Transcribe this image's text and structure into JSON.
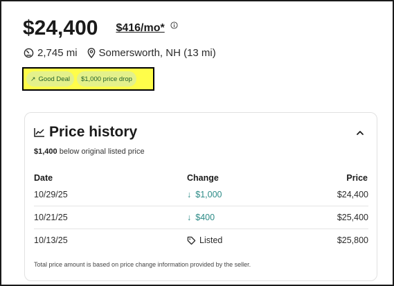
{
  "listing": {
    "price": "$24,400",
    "monthly": "$416/mo*",
    "mileage": "2,745 mi",
    "location": "Somersworth, NH (13 mi)"
  },
  "badges": [
    {
      "label": "Good Deal",
      "icon": "trend-up-arrow-icon"
    },
    {
      "label": "$1,000 price drop"
    }
  ],
  "price_history": {
    "title": "Price history",
    "below_amount": "$1,400",
    "below_text": "below original listed price",
    "columns": {
      "date": "Date",
      "change": "Change",
      "price": "Price"
    },
    "rows": [
      {
        "date": "10/29/25",
        "change": "$1,000",
        "change_type": "drop",
        "price": "$24,400"
      },
      {
        "date": "10/21/25",
        "change": "$400",
        "change_type": "drop",
        "price": "$25,400"
      },
      {
        "date": "10/13/25",
        "change": "Listed",
        "change_type": "listed",
        "price": "$25,800"
      }
    ],
    "footnote": "Total price amount is based on price change information provided by the seller."
  },
  "colors": {
    "highlight": "#fffd4a",
    "badge_bg": "#e4f18b",
    "badge_text": "#205f2a",
    "price_drop": "#2b8a86"
  }
}
